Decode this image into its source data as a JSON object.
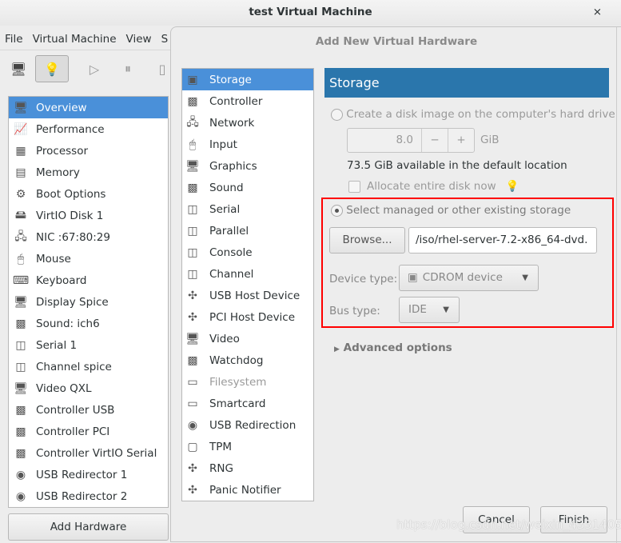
{
  "window": {
    "title": "test Virtual Machine",
    "close": "×"
  },
  "menu": [
    "File",
    "Virtual Machine",
    "View",
    "S"
  ],
  "toolbar": {
    "icons": [
      "monitor-icon",
      "lightbulb-icon",
      "play-icon",
      "pause-icon",
      "power-icon"
    ]
  },
  "left_list": [
    {
      "label": "Overview",
      "icon": "monitor-icon",
      "selected": true
    },
    {
      "label": "Performance",
      "icon": "performance-icon"
    },
    {
      "label": "Processor",
      "icon": "cpu-icon"
    },
    {
      "label": "Memory",
      "icon": "memory-icon"
    },
    {
      "label": "Boot Options",
      "icon": "gear-icon"
    },
    {
      "label": "VirtIO Disk 1",
      "icon": "disk-icon"
    },
    {
      "label": "NIC :67:80:29",
      "icon": "network-icon"
    },
    {
      "label": "Mouse",
      "icon": "mouse-icon"
    },
    {
      "label": "Keyboard",
      "icon": "keyboard-icon"
    },
    {
      "label": "Display Spice",
      "icon": "display-icon"
    },
    {
      "label": "Sound: ich6",
      "icon": "sound-icon"
    },
    {
      "label": "Serial 1",
      "icon": "serial-icon"
    },
    {
      "label": "Channel spice",
      "icon": "channel-icon"
    },
    {
      "label": "Video QXL",
      "icon": "video-icon"
    },
    {
      "label": "Controller USB",
      "icon": "controller-icon"
    },
    {
      "label": "Controller PCI",
      "icon": "controller-icon"
    },
    {
      "label": "Controller VirtIO Serial",
      "icon": "controller-icon"
    },
    {
      "label": "USB Redirector 1",
      "icon": "usb-icon"
    },
    {
      "label": "USB Redirector 2",
      "icon": "usb-icon"
    }
  ],
  "add_hardware": "Add Hardware",
  "dialog": {
    "title": "Add New Virtual Hardware",
    "items": [
      {
        "label": "Storage",
        "icon": "storage-icon",
        "selected": true
      },
      {
        "label": "Controller",
        "icon": "controller-icon"
      },
      {
        "label": "Network",
        "icon": "network-icon"
      },
      {
        "label": "Input",
        "icon": "mouse-icon"
      },
      {
        "label": "Graphics",
        "icon": "display-icon"
      },
      {
        "label": "Sound",
        "icon": "sound-icon"
      },
      {
        "label": "Serial",
        "icon": "serial-icon"
      },
      {
        "label": "Parallel",
        "icon": "parallel-icon"
      },
      {
        "label": "Console",
        "icon": "console-icon"
      },
      {
        "label": "Channel",
        "icon": "channel-icon"
      },
      {
        "label": "USB Host Device",
        "icon": "usb-host-icon"
      },
      {
        "label": "PCI Host Device",
        "icon": "pci-host-icon"
      },
      {
        "label": "Video",
        "icon": "video-icon"
      },
      {
        "label": "Watchdog",
        "icon": "watchdog-icon"
      },
      {
        "label": "Filesystem",
        "icon": "folder-icon",
        "disabled": true
      },
      {
        "label": "Smartcard",
        "icon": "smartcard-icon"
      },
      {
        "label": "USB Redirection",
        "icon": "usb-icon"
      },
      {
        "label": "TPM",
        "icon": "tpm-icon"
      },
      {
        "label": "RNG",
        "icon": "rng-icon"
      },
      {
        "label": "Panic Notifier",
        "icon": "panic-icon"
      }
    ],
    "panel": {
      "header": "Storage",
      "create_option": "Create a disk image on the computer's hard drive",
      "size_value": "8.0",
      "size_minus": "−",
      "size_plus": "+",
      "size_unit": "GiB",
      "available": "73.5 GiB available in the default location",
      "allocate": "Allocate entire disk now",
      "allocate_checked": false,
      "select_option": "Select managed or other existing storage",
      "selected_option": "select",
      "browse": "Browse...",
      "path": "/iso/rhel-server-7.2-x86_64-dvd.",
      "device_type_label": "Device type:",
      "device_type": "CDROM device",
      "bus_type_label": "Bus type:",
      "bus_type": "IDE",
      "advanced": "Advanced options"
    },
    "cancel": "Cancel",
    "finish": "Finish"
  },
  "highlight_color": "#ff0000",
  "accent": "#2a76ac",
  "watermark": "https://blog.csdn.net/weixin_43314056"
}
